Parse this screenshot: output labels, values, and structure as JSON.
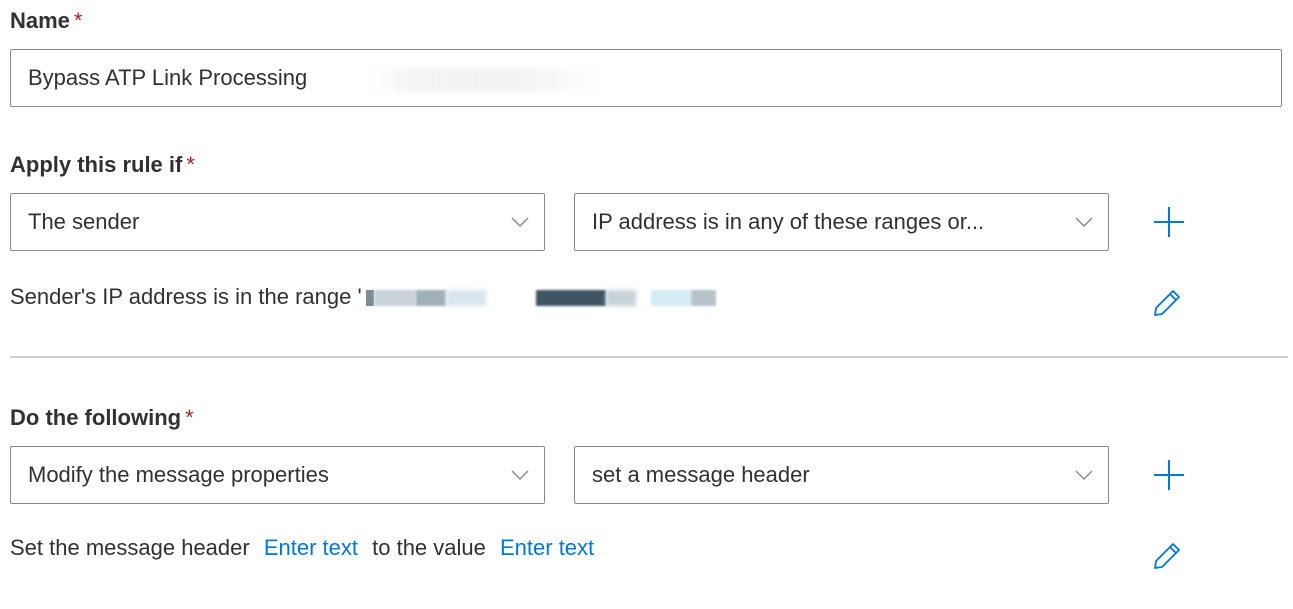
{
  "name_section": {
    "label": "Name",
    "required_marker": "*",
    "value": "Bypass ATP Link Processing"
  },
  "condition_section": {
    "label": "Apply this rule if",
    "required_marker": "*",
    "dropdown1_value": "The sender",
    "dropdown2_value": "IP address is in any of these ranges or...",
    "description": "Sender's IP address is in the range '"
  },
  "action_section": {
    "label": "Do the following",
    "required_marker": "*",
    "dropdown1_value": "Modify the message properties",
    "dropdown2_value": "set a message header",
    "desc_prefix": "Set the message header",
    "link1": "Enter text",
    "desc_middle": "to the value",
    "link2": "Enter text"
  },
  "icons": {
    "add": "plus-icon",
    "edit": "pencil-icon",
    "dropdown": "chevron-down-icon"
  },
  "colors": {
    "accent": "#0078d4",
    "required": "#a4262c",
    "border": "#8a8886",
    "divider": "#d2d0ce"
  }
}
